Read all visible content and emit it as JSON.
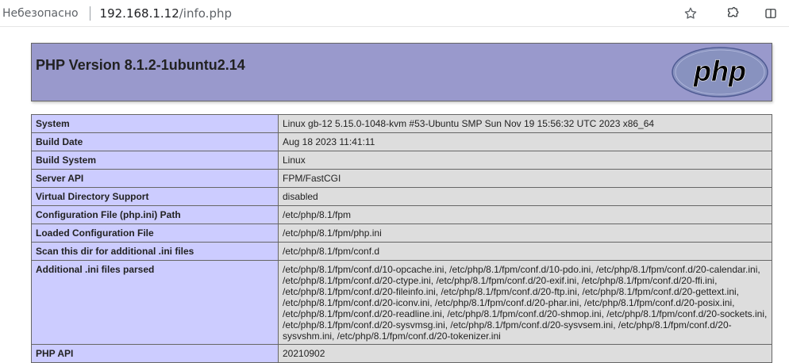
{
  "browser": {
    "security_label": "Небезопасно",
    "url_host": "192.168.1.12",
    "url_path": "/info.php",
    "icons": [
      "star-icon",
      "extensions-icon",
      "split-view-icon"
    ]
  },
  "header": {
    "title": "PHP Version 8.1.2-1ubuntu2.14",
    "logo_text": "php"
  },
  "rows": [
    {
      "key": "System",
      "value": "Linux gb-12 5.15.0-1048-kvm #53-Ubuntu SMP Sun Nov 19 15:56:32 UTC 2023 x86_64"
    },
    {
      "key": "Build Date",
      "value": "Aug 18 2023 11:41:11"
    },
    {
      "key": "Build System",
      "value": "Linux"
    },
    {
      "key": "Server API",
      "value": "FPM/FastCGI"
    },
    {
      "key": "Virtual Directory Support",
      "value": "disabled"
    },
    {
      "key": "Configuration File (php.ini) Path",
      "value": "/etc/php/8.1/fpm"
    },
    {
      "key": "Loaded Configuration File",
      "value": "/etc/php/8.1/fpm/php.ini"
    },
    {
      "key": "Scan this dir for additional .ini files",
      "value": "/etc/php/8.1/fpm/conf.d"
    },
    {
      "key": "Additional .ini files parsed",
      "value": "/etc/php/8.1/fpm/conf.d/10-opcache.ini, /etc/php/8.1/fpm/conf.d/10-pdo.ini, /etc/php/8.1/fpm/conf.d/20-calendar.ini, /etc/php/8.1/fpm/conf.d/20-ctype.ini, /etc/php/8.1/fpm/conf.d/20-exif.ini, /etc/php/8.1/fpm/conf.d/20-ffi.ini, /etc/php/8.1/fpm/conf.d/20-fileinfo.ini, /etc/php/8.1/fpm/conf.d/20-ftp.ini, /etc/php/8.1/fpm/conf.d/20-gettext.ini, /etc/php/8.1/fpm/conf.d/20-iconv.ini, /etc/php/8.1/fpm/conf.d/20-phar.ini, /etc/php/8.1/fpm/conf.d/20-posix.ini, /etc/php/8.1/fpm/conf.d/20-readline.ini, /etc/php/8.1/fpm/conf.d/20-shmop.ini, /etc/php/8.1/fpm/conf.d/20-sockets.ini, /etc/php/8.1/fpm/conf.d/20-sysvmsg.ini, /etc/php/8.1/fpm/conf.d/20-sysvsem.ini, /etc/php/8.1/fpm/conf.d/20-sysvshm.ini, /etc/php/8.1/fpm/conf.d/20-tokenizer.ini"
    },
    {
      "key": "PHP API",
      "value": "20210902"
    }
  ]
}
